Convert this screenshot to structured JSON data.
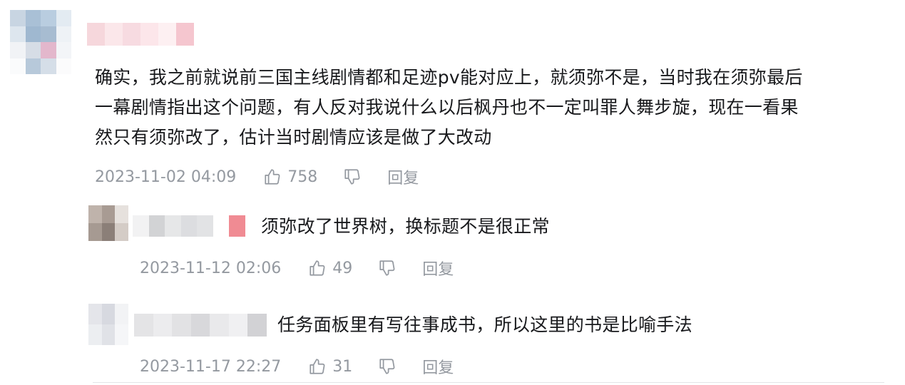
{
  "comments": [
    {
      "text": "确实，我之前就说前三国主线剧情都和足迹pv能对应上，就须弥不是，当时我在须弥最后一幕剧情指出这个问题，有人反对我说什么以后枫丹也不一定叫罪人舞步旋，现在一看果然只有须弥改了，估计当时剧情应该是做了大改动",
      "line1": "确实，我之前就说前三国主线剧情都和足迹pv能对应上，就须弥不是，当时我在须弥最后",
      "line2": "一幕剧情指出这个问题，有人反对我说什么以后枫丹也不一定叫罪人舞步旋，现在一看果",
      "line3": "然只有须弥改了，估计当时剧情应该是做了大改动",
      "time": "2023-11-02 04:09",
      "likes": "758",
      "reply_label": "回复"
    }
  ],
  "replies": [
    {
      "text": "须弥改了世界树，换标题不是很正常",
      "time": "2023-11-12 02:06",
      "likes": "49",
      "reply_label": "回复"
    },
    {
      "text": "任务面板里有写往事成书，所以这里的书是比喻手法",
      "time": "2023-11-17 22:27",
      "likes": "31",
      "reply_label": "回复"
    }
  ],
  "icons": {
    "like": "thumbs-up-icon",
    "dislike": "thumbs-down-icon"
  },
  "colors": {
    "text": "#18191c",
    "meta": "#9499a0",
    "divider": "#e3e5e7"
  }
}
